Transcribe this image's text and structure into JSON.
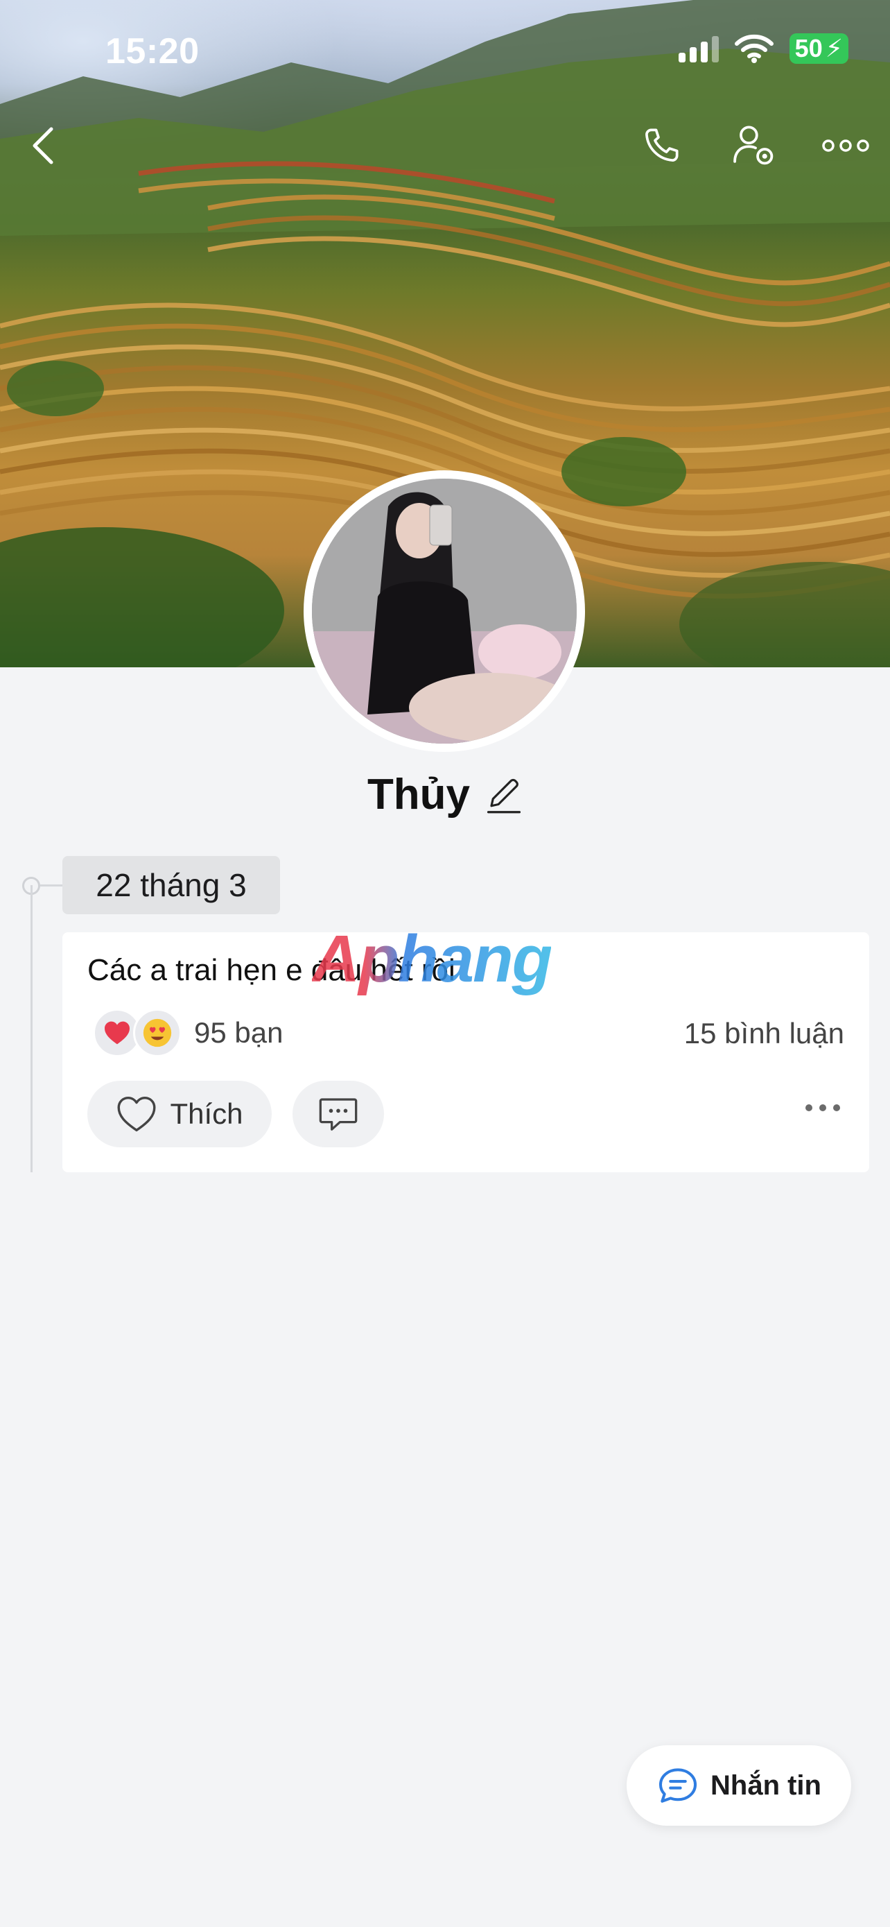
{
  "status_bar": {
    "time": "15:20",
    "battery": "50"
  },
  "profile": {
    "name": "Thủy"
  },
  "post": {
    "date": "22 tháng 3",
    "text": "Các a trai hẹn e đâu hết rồi",
    "watermark": "Aphang",
    "reactions": {
      "icons": [
        "heart",
        "heart-eyes"
      ],
      "count_label": "95 bạn"
    },
    "comments_label": "15 bình luận",
    "like_label": "Thích"
  },
  "message_button": {
    "label": "Nhắn tin"
  },
  "colors": {
    "accent": "#2f7de1",
    "battery": "#34c759",
    "heart": "#e8394d"
  }
}
